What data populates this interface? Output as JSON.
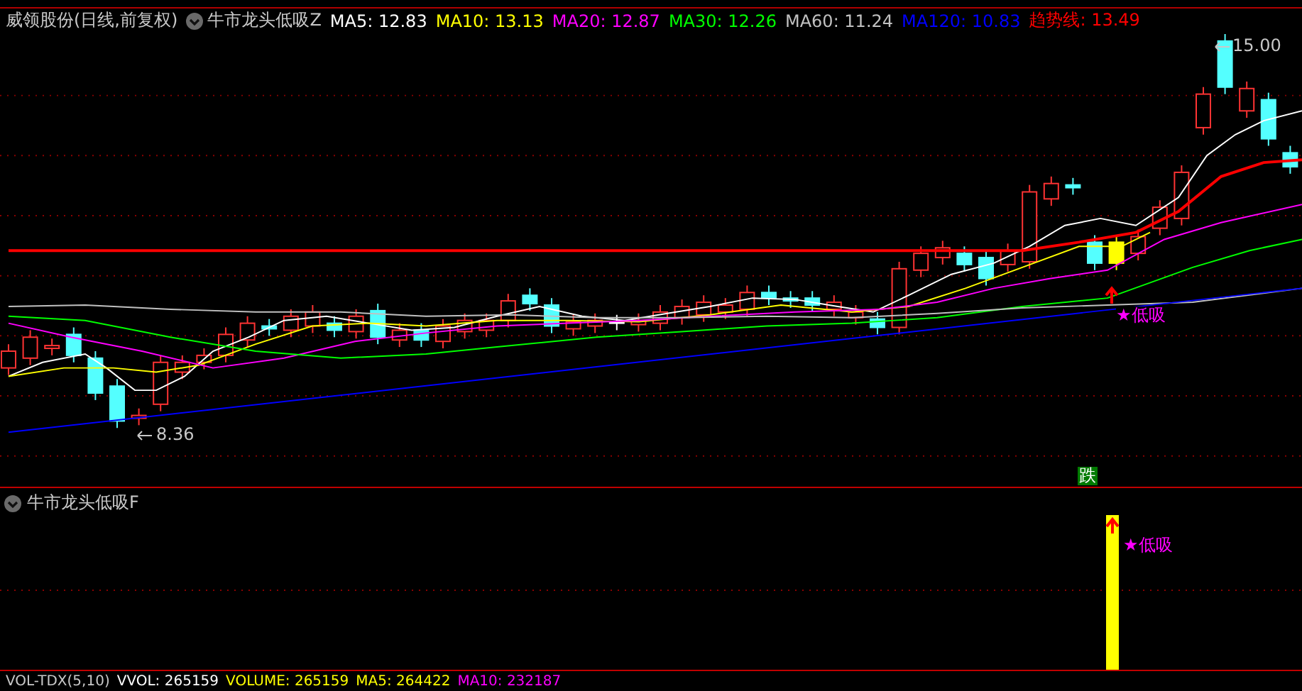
{
  "header": {
    "stock": "威领股份(日线,前复权)",
    "indicator": "牛市龙头低吸Z",
    "values": [
      {
        "label": "MA5: 12.83",
        "color": "#ffffff"
      },
      {
        "label": "MA10: 13.13",
        "color": "#ffff00"
      },
      {
        "label": "MA20: 12.87",
        "color": "#ff00ff"
      },
      {
        "label": "MA30: 12.26",
        "color": "#00ff00"
      },
      {
        "label": "MA60: 11.24",
        "color": "#c0c0c0"
      },
      {
        "label": "MA120: 10.83",
        "color": "#0000ff"
      },
      {
        "label": "趋势线: 13.49",
        "color": "#ff0000"
      }
    ]
  },
  "main_chart": {
    "high_label": "15.00",
    "low_label": "8.36",
    "signal_label": "★低吸",
    "marker": "跌"
  },
  "indicator_pane": {
    "title": "牛市龙头低吸F",
    "signal_label": "★低吸"
  },
  "volume_pane": {
    "title": "VOL-TDX(5,10)",
    "values": [
      {
        "label": "VVOL: 265159",
        "color": "#ffffff"
      },
      {
        "label": "VOLUME: 265159",
        "color": "#ffff00"
      },
      {
        "label": "MA5: 264422",
        "color": "#ffff00"
      },
      {
        "label": "MA10: 232187",
        "color": "#ff00ff"
      }
    ]
  }
}
